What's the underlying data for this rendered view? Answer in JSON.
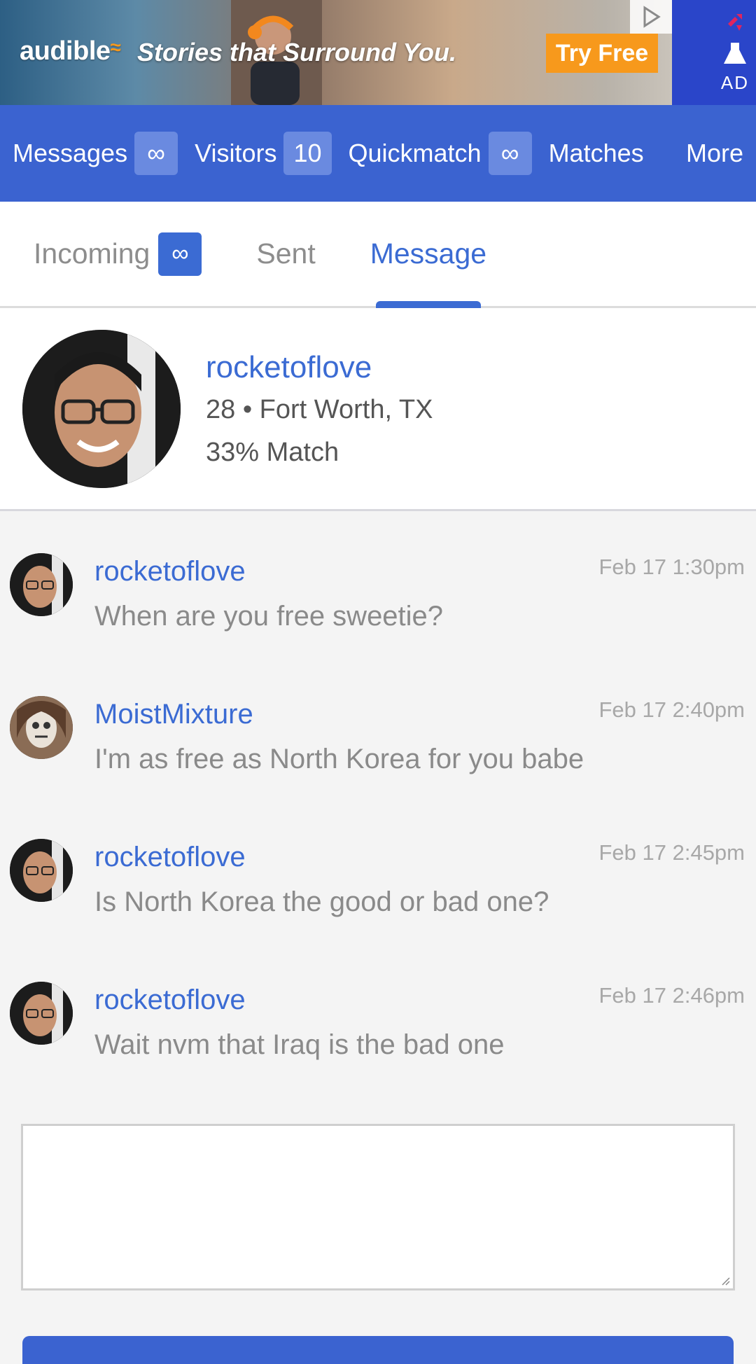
{
  "ad": {
    "brand": "audible",
    "tagline": "Stories that Surround You.",
    "cta": "Try Free",
    "badge": "AD",
    "icons": [
      "play-triangle-icon",
      "flask-icon",
      "brand-mark-icon"
    ],
    "colors": {
      "cta": "#f7991c",
      "side": "#2a45c9"
    }
  },
  "nav": {
    "items": [
      {
        "label": "Messages",
        "badge": "∞"
      },
      {
        "label": "Visitors",
        "badge": "10"
      },
      {
        "label": "Quickmatch",
        "badge": "∞"
      },
      {
        "label": "Matches"
      },
      {
        "label": "More"
      }
    ],
    "colors": {
      "background": "#3b63d0",
      "badge": "#6a8ae0"
    }
  },
  "tabs": {
    "items": [
      {
        "label": "Incoming",
        "badge": "∞"
      },
      {
        "label": "Sent"
      },
      {
        "label": "Message",
        "active": true
      }
    ],
    "colors": {
      "active": "#3b6bd3",
      "inactive": "#8d8d8d"
    }
  },
  "profile": {
    "username": "rocketoflove",
    "details": "28 • Fort Worth, TX",
    "match": "33% Match"
  },
  "messages": [
    {
      "sender": "rocketoflove",
      "time": "Feb 17 1:30pm",
      "text": "When are you free sweetie?"
    },
    {
      "sender": "MoistMixture",
      "time": "Feb 17 2:40pm",
      "text": "I'm as free as North Korea for you babe"
    },
    {
      "sender": "rocketoflove",
      "time": "Feb 17 2:45pm",
      "text": "Is North Korea the good or bad one?"
    },
    {
      "sender": "rocketoflove",
      "time": "Feb 17 2:46pm",
      "text": "Wait nvm that Iraq is the bad one"
    }
  ],
  "composer": {
    "value": "",
    "placeholder": ""
  }
}
